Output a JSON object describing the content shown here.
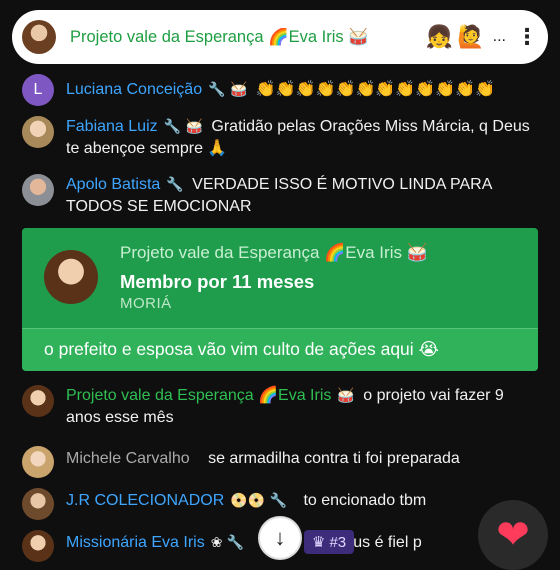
{
  "header": {
    "title": "Projeto vale da Esperança 🌈Eva Iris 🥁",
    "reactions": [
      "👧",
      "🙋"
    ],
    "more": "..."
  },
  "messages": [
    {
      "author": "Luciana Conceição",
      "badges": "🔧 🥁",
      "text": "👏👏👏👏👏👏👏👏👏👏👏👏",
      "avatar_letter": "L",
      "avatar_color": "#7e57c2"
    },
    {
      "author": "Fabiana Luiz",
      "badges": "🔧 🥁",
      "text": "Gratidão pelas Orações Miss Márcia, q Deus te abençoe sempre 🙏"
    },
    {
      "author": "Apolo Batista",
      "badges": "🔧",
      "text": "VERDADE ISSO É MOTIVO LINDA PARA TODOS SE EMOCIONAR"
    },
    {
      "author": "Projeto vale da Esperança 🌈Eva Iris",
      "badges": "🥁",
      "text": "o projeto vai fazer 9 anos esse mês"
    },
    {
      "author": "Michele Carvalho",
      "badges": "",
      "text": "se armadilha contra ti foi preparada"
    },
    {
      "author": "J.R COLECIONADOR",
      "badges": "📀📀 🔧",
      "text": "to encionado tbm"
    },
    {
      "author": "Missionária Eva Iris",
      "badges": "❀ 🔧",
      "text": "Deus é fiel p"
    }
  ],
  "membership": {
    "name": "Projeto vale da Esperança 🌈Eva Iris 🥁",
    "headline": "Membro por 11 meses",
    "level": "MORIÁ",
    "message": "o prefeito e esposa vão vim culto de ações aqui 😭"
  },
  "overlay": {
    "scroll_icon": "↓",
    "rank_label": "#3",
    "rank_icon": "♛",
    "heart": "❤"
  },
  "colors": {
    "accent_green": "#1f9d4c",
    "author_blue": "#3ea6ff",
    "background": "#0f0f0f"
  }
}
